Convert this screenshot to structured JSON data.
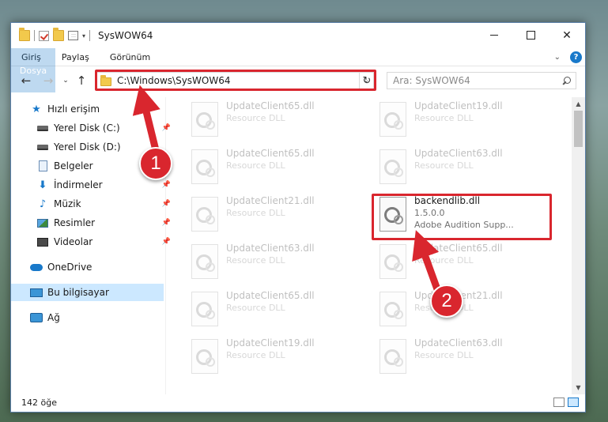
{
  "window": {
    "title": "SysWOW64",
    "close_glyph": "✕"
  },
  "ribbon": {
    "tabs": [
      "Dosya",
      "Giriş",
      "Paylaş",
      "Görünüm"
    ],
    "collapse_glyph": "⌄",
    "help_glyph": "?"
  },
  "address": {
    "path": "C:\\Windows\\SysWOW64",
    "refresh_glyph": "↻",
    "dropdown_glyph": "⌄"
  },
  "search": {
    "placeholder": "Ara: SysWOW64"
  },
  "nav_glyphs": {
    "back": "←",
    "forward": "→",
    "recent": "⌄",
    "up": "↑"
  },
  "sidebar": {
    "items": [
      {
        "label": "Hızlı erişim",
        "icon": "star-icon"
      },
      {
        "label": "Yerel Disk (C:)",
        "icon": "disk-icon"
      },
      {
        "label": "Yerel Disk (D:)",
        "icon": "disk-icon"
      },
      {
        "label": "Belgeler",
        "icon": "document-icon"
      },
      {
        "label": "İndirmeler",
        "icon": "download-icon"
      },
      {
        "label": "Müzik",
        "icon": "music-icon"
      },
      {
        "label": "Resimler",
        "icon": "pictures-icon"
      },
      {
        "label": "Videolar",
        "icon": "videos-icon"
      },
      {
        "label": "OneDrive",
        "icon": "cloud-icon"
      },
      {
        "label": "Bu bilgisayar",
        "icon": "computer-icon"
      },
      {
        "label": "Ağ",
        "icon": "network-icon"
      }
    ],
    "pin_glyph": "📌",
    "star_glyph": "★",
    "download_glyph": "⬇",
    "music_glyph": "♪"
  },
  "files": {
    "left": [
      {
        "name": "UpdateClient65.dll",
        "type": "Resource DLL"
      },
      {
        "name": "UpdateClient65.dll",
        "type": "Resource DLL"
      },
      {
        "name": "UpdateClient21.dll",
        "type": "Resource DLL"
      },
      {
        "name": "UpdateClient63.dll",
        "type": "Resource DLL"
      },
      {
        "name": "UpdateClient65.dll",
        "type": "Resource DLL"
      },
      {
        "name": "UpdateClient19.dll",
        "type": "Resource DLL"
      }
    ],
    "right": [
      {
        "name": "UpdateClient19.dll",
        "type": "Resource DLL"
      },
      {
        "name": "UpdateClient63.dll",
        "type": "Resource DLL"
      },
      {
        "name": "UpdateClient65.dll",
        "type": "Resource DLL"
      },
      {
        "name": "UpdateClient21.dll",
        "type": "Resource DLL"
      },
      {
        "name": "UpdateClient63.dll",
        "type": "Resource DLL"
      }
    ],
    "highlighted": {
      "name": "backendlib.dll",
      "version": "1.5.0.0",
      "description": "Adobe Audition Supp..."
    }
  },
  "scroll_glyphs": {
    "up": "▲",
    "down": "▼"
  },
  "status": {
    "item_count": "142 öğe"
  },
  "annotations": {
    "step1": "1",
    "step2": "2",
    "color": "#d9262e"
  }
}
